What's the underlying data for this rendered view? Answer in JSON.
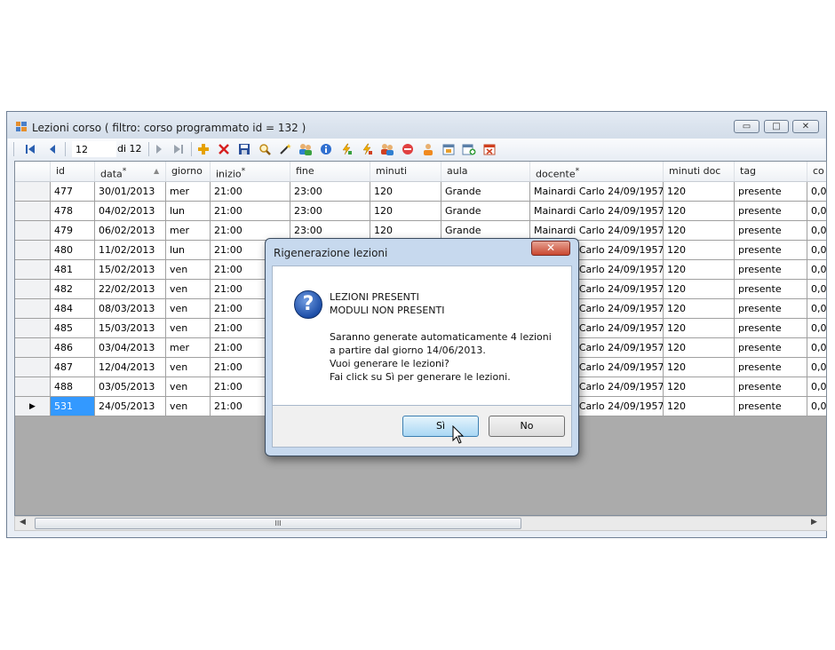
{
  "window": {
    "title": "Lezioni corso ( filtro: corso programmato id = 132 )",
    "controls": {
      "minimize": "▭",
      "maximize": "□",
      "close": "✕"
    }
  },
  "toolbar": {
    "position": "12",
    "count_label": "di 12",
    "icons": [
      "move-first-icon",
      "move-previous-icon",
      "move-next-icon",
      "move-last-icon",
      "add-icon",
      "delete-icon",
      "save-icon",
      "search-icon",
      "wand-icon",
      "users-icon",
      "info-icon",
      "lightning-icon",
      "lightning-2-icon",
      "people-icon",
      "stop-icon",
      "person-icon",
      "calendar-icon",
      "calendar-add-icon",
      "calendar-delete-icon"
    ]
  },
  "grid": {
    "columns": [
      "id",
      "data",
      "giorno",
      "inizio",
      "fine",
      "minuti",
      "aula",
      "docente",
      "minuti doc",
      "tag",
      "co"
    ],
    "rows": [
      [
        "477",
        "30/01/2013",
        "mer",
        "21:00",
        "23:00",
        "120",
        "Grande",
        "Mainardi Carlo 24/09/1957",
        "120",
        "presente",
        "0,0"
      ],
      [
        "478",
        "04/02/2013",
        "lun",
        "21:00",
        "23:00",
        "120",
        "Grande",
        "Mainardi Carlo 24/09/1957",
        "120",
        "presente",
        "0,0"
      ],
      [
        "479",
        "06/02/2013",
        "mer",
        "21:00",
        "23:00",
        "120",
        "Grande",
        "Mainardi Carlo 24/09/1957",
        "120",
        "presente",
        "0,0"
      ],
      [
        "480",
        "11/02/2013",
        "lun",
        "21:00",
        "",
        "",
        "",
        "Mainardi Carlo 24/09/1957",
        "120",
        "presente",
        "0,0"
      ],
      [
        "481",
        "15/02/2013",
        "ven",
        "21:00",
        "",
        "",
        "",
        "Mainardi Carlo 24/09/1957",
        "120",
        "presente",
        "0,0"
      ],
      [
        "482",
        "22/02/2013",
        "ven",
        "21:00",
        "",
        "",
        "",
        "Mainardi Carlo 24/09/1957",
        "120",
        "presente",
        "0,0"
      ],
      [
        "484",
        "08/03/2013",
        "ven",
        "21:00",
        "",
        "",
        "",
        "Mainardi Carlo 24/09/1957",
        "120",
        "presente",
        "0,0"
      ],
      [
        "485",
        "15/03/2013",
        "ven",
        "21:00",
        "",
        "",
        "",
        "Mainardi Carlo 24/09/1957",
        "120",
        "presente",
        "0,0"
      ],
      [
        "486",
        "03/04/2013",
        "mer",
        "21:00",
        "",
        "",
        "",
        "Mainardi Carlo 24/09/1957",
        "120",
        "presente",
        "0,0"
      ],
      [
        "487",
        "12/04/2013",
        "ven",
        "21:00",
        "",
        "",
        "",
        "Mainardi Carlo 24/09/1957",
        "120",
        "presente",
        "0,0"
      ],
      [
        "488",
        "03/05/2013",
        "ven",
        "21:00",
        "",
        "",
        "",
        "Mainardi Carlo 24/09/1957",
        "120",
        "presente",
        "0,0"
      ],
      [
        "531",
        "24/05/2013",
        "ven",
        "21:00",
        "",
        "",
        "",
        "Mainardi Carlo 24/09/1957",
        "120",
        "presente",
        "0,0"
      ]
    ],
    "current_row_marker": "▶",
    "scrollbar_grip": "III"
  },
  "dialog": {
    "title": "Rigenerazione lezioni",
    "close_label": "✕",
    "heading_lines": [
      "LEZIONI PRESENTI",
      "MODULI NON PRESENTI"
    ],
    "message_lines": [
      "Saranno generate automaticamente 4 lezioni",
      "a partire dal giorno 14/06/2013.",
      "Vuoi generare le lezioni?",
      "Fai click su Sì per generare le lezioni."
    ],
    "icon_glyph": "?",
    "yes_label": "Sì",
    "no_label": "No"
  },
  "colors": {
    "selection": "#3399ff",
    "grid_background": "#ababab",
    "close_button": "#c9472f"
  }
}
